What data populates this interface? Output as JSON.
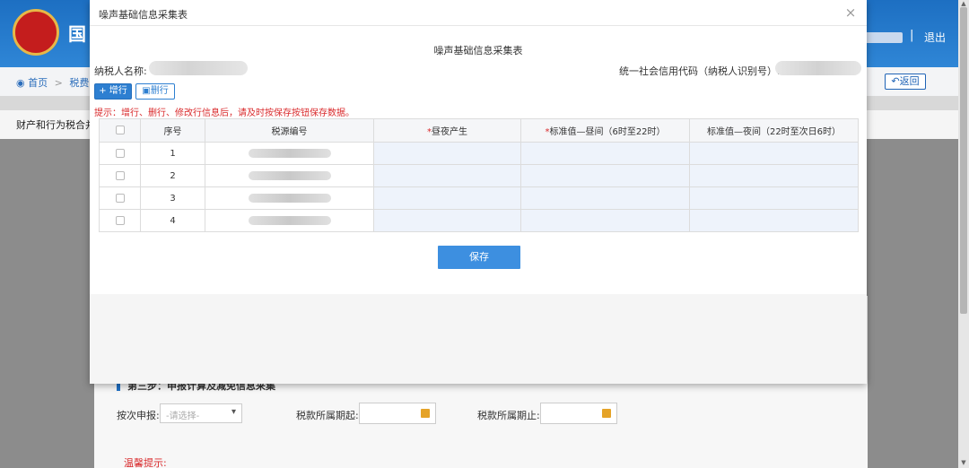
{
  "background": {
    "brand_char": "国",
    "logout": "退出",
    "separator": "|",
    "breadcrumb": {
      "home": "首页",
      "next": "税费申",
      "sep": ">"
    },
    "back_button": "返回",
    "tab_label": "财产和行为税合并",
    "step_title": "第三步：申报计算及减免信息采集",
    "filing_label": "按次申报:",
    "filing_select_placeholder": "-请选择-",
    "period_start_label": "税款所属期起:",
    "period_end_label": "税款所属期止:",
    "warm_tip": "温馨提示:"
  },
  "modal": {
    "title": "噪声基础信息采集表",
    "close_icon": "×",
    "form_title": "噪声基础信息采集表",
    "taxpayer_label": "纳税人名称:",
    "credit_label": "统一社会信用代码（纳税人识别号）:",
    "add_button": "+ 增行",
    "delete_button": "删行",
    "tip": "提示：增行、删行、修改行信息后，请及时按保存按钮保存数据。",
    "save_button": "保存",
    "table": {
      "columns": {
        "seq": "序号",
        "source": "税源编号",
        "day_night_star": "*",
        "day_night": "昼夜产生",
        "std_day_star": "*",
        "std_day": "标准值—昼间（6时至22时）",
        "std_night": "标准值—夜间（22时至次日6时）"
      },
      "rows": [
        {
          "seq": "1"
        },
        {
          "seq": "2"
        },
        {
          "seq": "3"
        },
        {
          "seq": "4"
        }
      ]
    }
  },
  "colors": {
    "header_blue": "#1d6fc2",
    "accent": "#2d7fd1",
    "warning_red": "#d9292b",
    "editable_cell": "#eef3fb"
  }
}
